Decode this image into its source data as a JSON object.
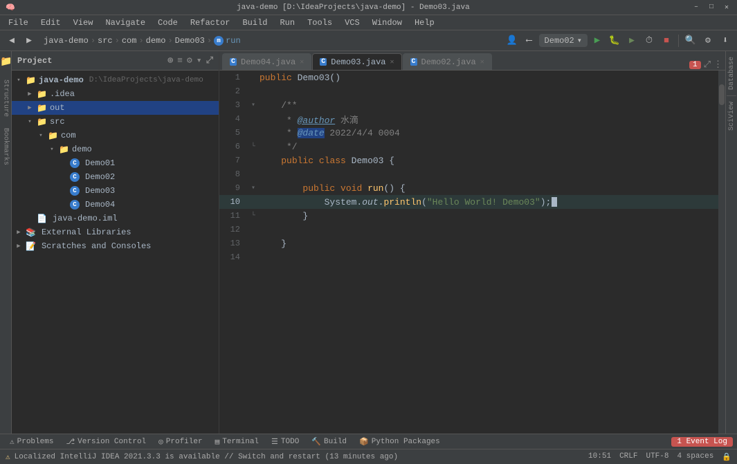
{
  "titlebar": {
    "title": "java-demo [D:\\IdeaProjects\\java-demo] - Demo03.java",
    "controls": [
      "–",
      "□",
      "✕"
    ]
  },
  "menubar": {
    "items": [
      "File",
      "Edit",
      "View",
      "Navigate",
      "Code",
      "Refactor",
      "Build",
      "Run",
      "Tools",
      "VCS",
      "Window",
      "Help"
    ]
  },
  "toolbar": {
    "project_name": "java-demo",
    "breadcrumb": [
      "src",
      "com",
      "demo",
      "Demo03",
      "run"
    ],
    "run_config": "Demo02",
    "search_icon": "🔍",
    "update_icon": "⬇"
  },
  "project_panel": {
    "title": "Project",
    "tree": [
      {
        "indent": 0,
        "label": "java-demo",
        "subtitle": "D:\\IdeaProjects\\java-demo",
        "type": "root",
        "expanded": true
      },
      {
        "indent": 1,
        "label": ".idea",
        "type": "folder",
        "expanded": false
      },
      {
        "indent": 1,
        "label": "out",
        "type": "folder",
        "expanded": false,
        "selected": true
      },
      {
        "indent": 1,
        "label": "src",
        "type": "folder",
        "expanded": true
      },
      {
        "indent": 2,
        "label": "com",
        "type": "folder",
        "expanded": true
      },
      {
        "indent": 3,
        "label": "demo",
        "type": "folder",
        "expanded": true
      },
      {
        "indent": 4,
        "label": "Demo01",
        "type": "java-class"
      },
      {
        "indent": 4,
        "label": "Demo02",
        "type": "java-class"
      },
      {
        "indent": 4,
        "label": "Demo03",
        "type": "java-class"
      },
      {
        "indent": 4,
        "label": "Demo04",
        "type": "java-class"
      },
      {
        "indent": 1,
        "label": "java-demo.iml",
        "type": "iml"
      },
      {
        "indent": 0,
        "label": "External Libraries",
        "type": "folder-special",
        "expanded": false
      },
      {
        "indent": 0,
        "label": "Scratches and Consoles",
        "type": "folder-special",
        "expanded": false
      }
    ]
  },
  "editor": {
    "tabs": [
      {
        "label": "Demo04.java",
        "active": false,
        "icon": "C"
      },
      {
        "label": "Demo03.java",
        "active": true,
        "icon": "C"
      },
      {
        "label": "Demo02.java",
        "active": false,
        "icon": "C"
      }
    ],
    "warning_count": "1",
    "lines": [
      {
        "num": 1,
        "content": "    public Demo03()",
        "tokens": [
          {
            "t": "kw",
            "v": "public"
          },
          {
            "t": "",
            "v": " Demo03()"
          }
        ],
        "gutter": ""
      },
      {
        "num": 2,
        "content": "",
        "tokens": [],
        "gutter": ""
      },
      {
        "num": 3,
        "content": "    /**",
        "tokens": [
          {
            "t": "cm",
            "v": "    /**"
          }
        ],
        "gutter": "fold"
      },
      {
        "num": 4,
        "content": "     * @author 水滴",
        "tokens": [
          {
            "t": "cm",
            "v": "     * "
          },
          {
            "t": "at-name",
            "v": "@author"
          },
          {
            "t": "cm",
            "v": " 水滴"
          }
        ],
        "gutter": ""
      },
      {
        "num": 5,
        "content": "     * @date 2022/4/4 0004",
        "tokens": [
          {
            "t": "cm",
            "v": "     * "
          },
          {
            "t": "at-hl",
            "v": "@date"
          },
          {
            "t": "cm",
            "v": " 2022/4/4 0004"
          }
        ],
        "gutter": ""
      },
      {
        "num": 6,
        "content": "     */",
        "tokens": [
          {
            "t": "cm",
            "v": "     */"
          }
        ],
        "gutter": "fold-end"
      },
      {
        "num": 7,
        "content": "    public class Demo03 {",
        "tokens": [
          {
            "t": "kw",
            "v": "    public"
          },
          {
            "t": "",
            "v": " "
          },
          {
            "t": "kw",
            "v": "class"
          },
          {
            "t": "",
            "v": " Demo03 {"
          }
        ],
        "gutter": ""
      },
      {
        "num": 8,
        "content": "",
        "tokens": [],
        "gutter": ""
      },
      {
        "num": 9,
        "content": "        public void run() {",
        "tokens": [
          {
            "t": "kw",
            "v": "        public"
          },
          {
            "t": "",
            "v": " "
          },
          {
            "t": "kw",
            "v": "void"
          },
          {
            "t": "",
            "v": " "
          },
          {
            "t": "fn",
            "v": "run"
          },
          {
            "t": "",
            "v": "() {"
          }
        ],
        "gutter": "fold-open"
      },
      {
        "num": 10,
        "content": "            System.out.println(\"Hello World! Demo03\");",
        "tokens": [
          {
            "t": "",
            "v": "            System."
          },
          {
            "t": "it",
            "v": "out"
          },
          {
            "t": "",
            "v": "."
          },
          {
            "t": "fn",
            "v": "println"
          },
          {
            "t": "",
            "v": "("
          },
          {
            "t": "str",
            "v": "\"Hello World! Demo03\""
          },
          {
            "t": "",
            "v": "};"
          }
        ],
        "gutter": ""
      },
      {
        "num": 11,
        "content": "        }",
        "tokens": [
          {
            "t": "",
            "v": "        }"
          }
        ],
        "gutter": "fold-close"
      },
      {
        "num": 12,
        "content": "",
        "tokens": [],
        "gutter": ""
      },
      {
        "num": 13,
        "content": "    }",
        "tokens": [
          {
            "t": "",
            "v": "    }"
          }
        ],
        "gutter": ""
      },
      {
        "num": 14,
        "content": "",
        "tokens": [],
        "gutter": ""
      }
    ]
  },
  "right_panels": {
    "labels": [
      "Database",
      "SciView"
    ]
  },
  "bottom_toolbar": {
    "tabs": [
      {
        "label": "Problems",
        "icon": "⚠",
        "active": false
      },
      {
        "label": "Version Control",
        "icon": "⎇",
        "active": false
      },
      {
        "label": "Profiler",
        "icon": "◎",
        "active": false
      },
      {
        "label": "Terminal",
        "icon": "▤",
        "active": false
      },
      {
        "label": "TODO",
        "icon": "☰",
        "active": false
      },
      {
        "label": "Build",
        "icon": "🔨",
        "active": false
      },
      {
        "label": "Python Packages",
        "icon": "📦",
        "active": false
      }
    ],
    "event_log": "1 Event Log"
  },
  "statusbar": {
    "message": "Localized IntelliJ IDEA 2021.3.3 is available // Switch and restart (13 minutes ago)",
    "time": "10:51",
    "line_ending": "CRLF",
    "encoding": "UTF-8",
    "indent": "4 spaces",
    "lock_icon": "🔒"
  }
}
